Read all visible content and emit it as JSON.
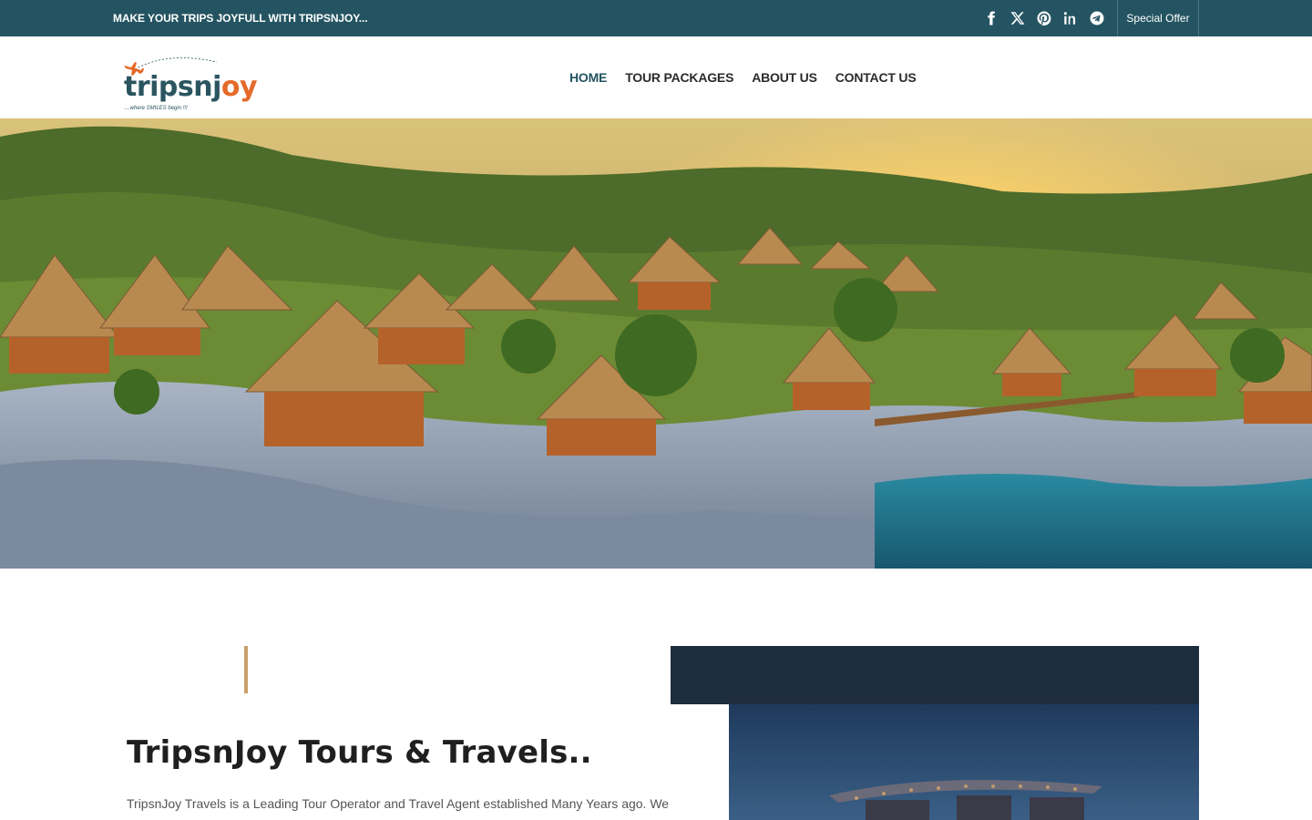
{
  "topbar": {
    "tagline": "MAKE YOUR TRIPS JOYFULL WITH TRIPSNJOY...",
    "social_icons": [
      "facebook-icon",
      "x-icon",
      "pinterest-icon",
      "linkedin-icon",
      "telegram-icon"
    ],
    "special_offer": "Special Offer",
    "bg_color": "#245461"
  },
  "header": {
    "logo": {
      "text_main": "tripsnj",
      "text_accent": "oy",
      "slogan": "....where SMILES begin !!!"
    },
    "nav": [
      {
        "label": "HOME",
        "active": true
      },
      {
        "label": "TOUR PACKAGES",
        "active": false
      },
      {
        "label": "ABOUT US",
        "active": false
      },
      {
        "label": "CONTACT US",
        "active": false
      }
    ]
  },
  "about": {
    "title": "TripsnJoy Tours & Travels..",
    "text": "TripsnJoy Travels is a Leading Tour Operator and Travel Agent established Many Years ago. We are In"
  },
  "colors": {
    "brand_dark": "#245461",
    "brand_orange": "#e46a2a",
    "accent_gold": "#c8a06a"
  }
}
